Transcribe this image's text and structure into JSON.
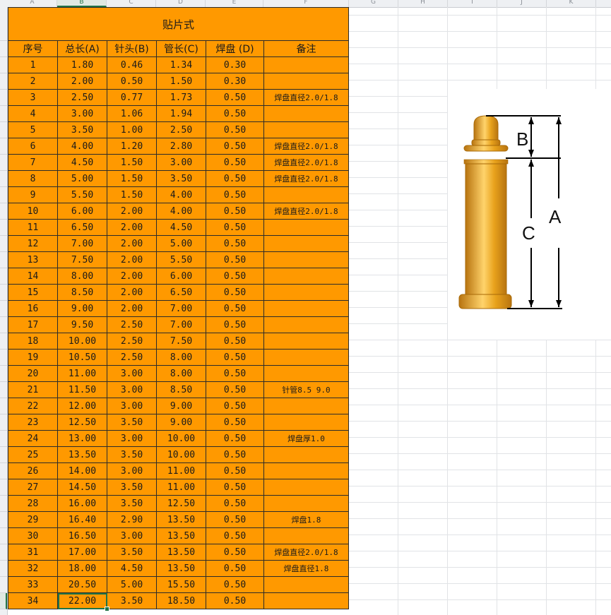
{
  "column_letters": [
    "A",
    "B",
    "C",
    "D",
    "E",
    "F",
    "G",
    "H",
    "I",
    "J",
    "K"
  ],
  "active_column": "B",
  "table": {
    "title": "贴片式",
    "headers": [
      "序号",
      "总长(A)",
      "针头(B)",
      "管长(C)",
      "焊盘 (D)",
      "备注"
    ],
    "rows": [
      [
        "1",
        "1.80",
        "0.46",
        "1.34",
        "0.30",
        ""
      ],
      [
        "2",
        "2.00",
        "0.50",
        "1.50",
        "0.30",
        ""
      ],
      [
        "3",
        "2.50",
        "0.77",
        "1.73",
        "0.50",
        "焊盘直径2.0/1.8"
      ],
      [
        "4",
        "3.00",
        "1.06",
        "1.94",
        "0.50",
        ""
      ],
      [
        "5",
        "3.50",
        "1.00",
        "2.50",
        "0.50",
        ""
      ],
      [
        "6",
        "4.00",
        "1.20",
        "2.80",
        "0.50",
        "焊盘直径2.0/1.8"
      ],
      [
        "7",
        "4.50",
        "1.50",
        "3.00",
        "0.50",
        "焊盘直径2.0/1.8"
      ],
      [
        "8",
        "5.00",
        "1.50",
        "3.50",
        "0.50",
        "焊盘直径2.0/1.8"
      ],
      [
        "9",
        "5.50",
        "1.50",
        "4.00",
        "0.50",
        ""
      ],
      [
        "10",
        "6.00",
        "2.00",
        "4.00",
        "0.50",
        "焊盘直径2.0/1.8"
      ],
      [
        "11",
        "6.50",
        "2.00",
        "4.50",
        "0.50",
        ""
      ],
      [
        "12",
        "7.00",
        "2.00",
        "5.00",
        "0.50",
        ""
      ],
      [
        "13",
        "7.50",
        "2.00",
        "5.50",
        "0.50",
        ""
      ],
      [
        "14",
        "8.00",
        "2.00",
        "6.00",
        "0.50",
        ""
      ],
      [
        "15",
        "8.50",
        "2.00",
        "6.50",
        "0.50",
        ""
      ],
      [
        "16",
        "9.00",
        "2.00",
        "7.00",
        "0.50",
        ""
      ],
      [
        "17",
        "9.50",
        "2.50",
        "7.00",
        "0.50",
        ""
      ],
      [
        "18",
        "10.00",
        "2.50",
        "7.50",
        "0.50",
        ""
      ],
      [
        "19",
        "10.50",
        "2.50",
        "8.00",
        "0.50",
        ""
      ],
      [
        "20",
        "11.00",
        "3.00",
        "8.00",
        "0.50",
        ""
      ],
      [
        "21",
        "11.50",
        "3.00",
        "8.50",
        "0.50",
        "针管8.5 9.0"
      ],
      [
        "22",
        "12.00",
        "3.00",
        "9.00",
        "0.50",
        ""
      ],
      [
        "23",
        "12.50",
        "3.50",
        "9.00",
        "0.50",
        ""
      ],
      [
        "24",
        "13.00",
        "3.00",
        "10.00",
        "0.50",
        "焊盘厚1.0"
      ],
      [
        "25",
        "13.50",
        "3.50",
        "10.00",
        "0.50",
        ""
      ],
      [
        "26",
        "14.00",
        "3.00",
        "11.00",
        "0.50",
        ""
      ],
      [
        "27",
        "14.50",
        "3.50",
        "11.00",
        "0.50",
        ""
      ],
      [
        "28",
        "16.00",
        "3.50",
        "12.50",
        "0.50",
        ""
      ],
      [
        "29",
        "16.40",
        "2.90",
        "13.50",
        "0.50",
        "焊盘1.8"
      ],
      [
        "30",
        "16.50",
        "3.00",
        "13.50",
        "0.50",
        ""
      ],
      [
        "31",
        "17.00",
        "3.50",
        "13.50",
        "0.50",
        "焊盘直径2.0/1.8"
      ],
      [
        "32",
        "18.00",
        "4.50",
        "13.50",
        "0.50",
        "焊盘直径1.8"
      ],
      [
        "33",
        "20.50",
        "5.00",
        "15.50",
        "0.50",
        ""
      ],
      [
        "34",
        "22.00",
        "3.50",
        "18.50",
        "0.50",
        ""
      ]
    ]
  },
  "figure": {
    "label_a": "A",
    "label_b": "B",
    "label_c": "C",
    "pin_color": "#e8a21c",
    "pin_shade": "#b87410"
  },
  "colors": {
    "cell_fill": "#ff9900",
    "selection": "#217346"
  }
}
